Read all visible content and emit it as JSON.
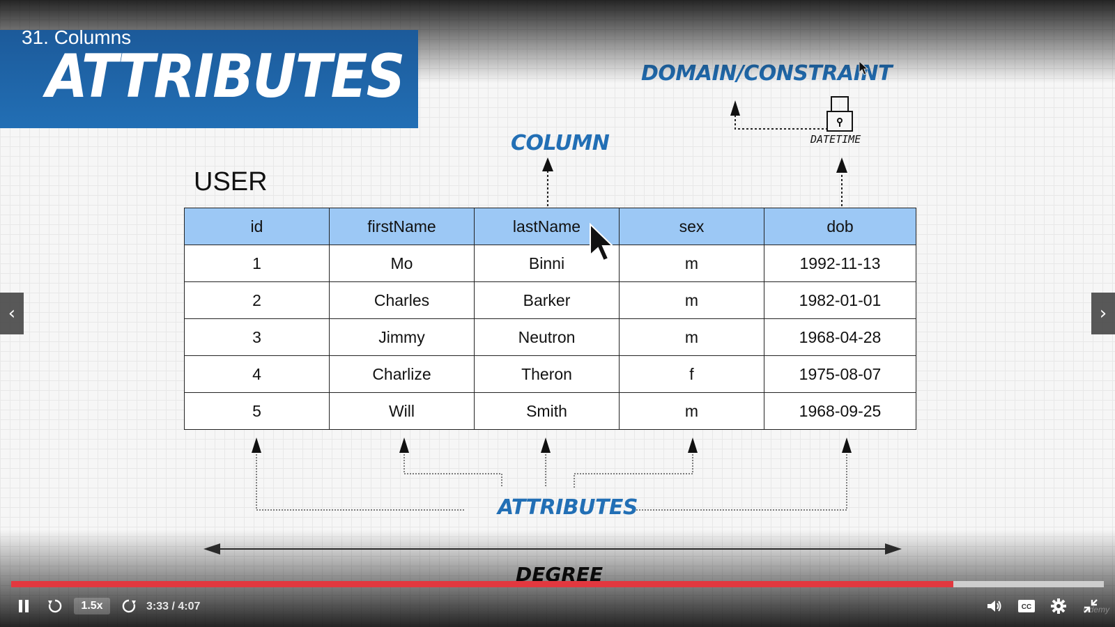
{
  "lecture": {
    "title": "31. Columns"
  },
  "slide": {
    "banner_title": "ATTRIBUTES",
    "labels": {
      "column": "COLUMN",
      "domain_constraint": "DOMAIN/CONSTRAINT",
      "datatype": "DATETIME",
      "attributes": "ATTRIBUTES",
      "degree": "DEGREE"
    },
    "table": {
      "name": "USER",
      "headers": [
        "id",
        "firstName",
        "lastName",
        "sex",
        "dob"
      ],
      "rows": [
        [
          "1",
          "Mo",
          "Binni",
          "m",
          "1992-11-13"
        ],
        [
          "2",
          "Charles",
          "Barker",
          "m",
          "1982-01-01"
        ],
        [
          "3",
          "Jimmy",
          "Neutron",
          "m",
          "1968-04-28"
        ],
        [
          "4",
          "Charlize",
          "Theron",
          "f",
          "1975-08-07"
        ],
        [
          "5",
          "Will",
          "Smith",
          "m",
          "1968-09-25"
        ]
      ]
    },
    "colors": {
      "banner_blue": "#226fb5",
      "header_blue": "#9cc8f5",
      "label_blue": "#226fb5"
    }
  },
  "player": {
    "speed": "1.5x",
    "time": "3:33 / 4:07",
    "progress_fraction": 0.862,
    "watermark": "Udemy",
    "icons": {
      "pause": "pause-icon",
      "rewind": "rewind-icon",
      "forward": "forward-icon",
      "volume": "volume-icon",
      "captions": "captions-icon",
      "settings": "gear-icon",
      "fullscreen": "exit-fullscreen-icon",
      "prev": "chevron-left-icon",
      "next": "chevron-right-icon"
    },
    "accent_color": "#e2383f"
  }
}
